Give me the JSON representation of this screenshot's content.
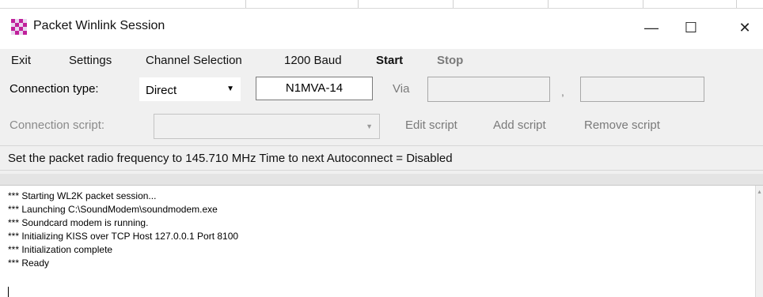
{
  "window": {
    "title": "Packet Winlink Session",
    "controls": {
      "minimize": "—",
      "maximize": "☐",
      "close": "✕"
    }
  },
  "menu": {
    "items": [
      {
        "label": "Exit"
      },
      {
        "label": "Settings"
      },
      {
        "label": "Channel Selection"
      },
      {
        "label": "1200 Baud"
      },
      {
        "label": "Start"
      },
      {
        "label": "Stop"
      }
    ]
  },
  "connection": {
    "type_label": "Connection type:",
    "type_value": "Direct",
    "callsign": "N1MVA-14",
    "via_label": "Via",
    "via1": "",
    "via_separator": ",",
    "via2": ""
  },
  "script": {
    "label": "Connection script:",
    "value": "",
    "edit": "Edit script",
    "add": "Add script",
    "remove": "Remove script"
  },
  "status": {
    "text": "Set the packet radio frequency to 145.710 MHz  Time to next Autoconnect = Disabled"
  },
  "log": {
    "lines": [
      "*** Starting WL2K packet session...",
      "*** Launching C:\\SoundModem\\soundmodem.exe",
      "*** Soundcard modem is running.",
      "*** Initializing KISS over TCP Host 127.0.0.1 Port 8100",
      "*** Initialization complete",
      "*** Ready"
    ]
  }
}
